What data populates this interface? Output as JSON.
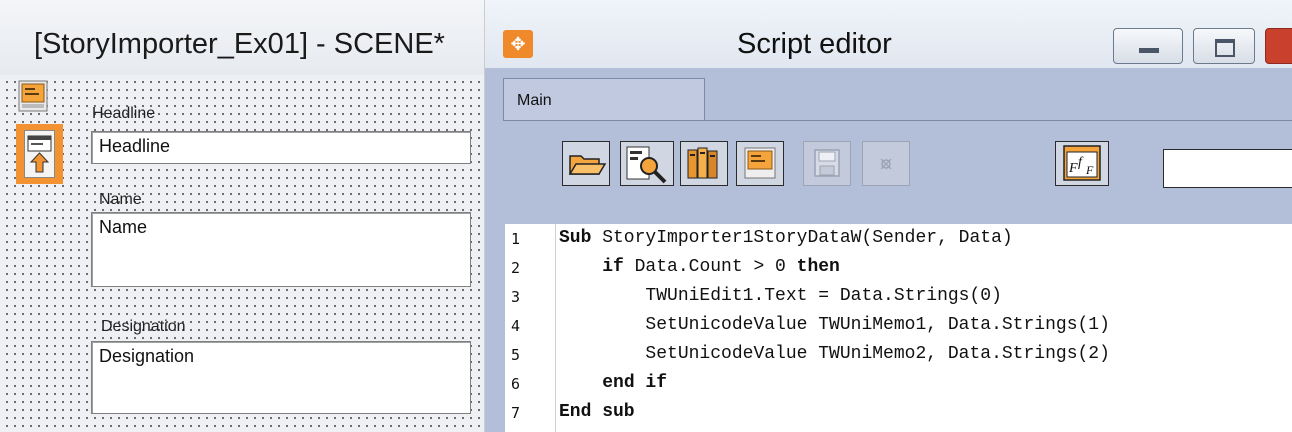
{
  "designer": {
    "title": "[StoryImporter_Ex01] - SCENE*",
    "fields": [
      {
        "label": "Headline",
        "value": "Headline"
      },
      {
        "label": "Name",
        "value": "Name"
      },
      {
        "label": "Designation",
        "value": "Designation"
      }
    ]
  },
  "editor": {
    "title": "Script editor",
    "tab": "Main",
    "toolbar": [
      "open-icon",
      "object-inspector-icon",
      "library-icon",
      "form-icon",
      "save-icon",
      "disabled-icon",
      "function-icon"
    ],
    "field_value": "",
    "lines": [
      {
        "num": "1",
        "kw1": "Sub",
        "text": " StoryImporter1StoryDataW(Sender, Data)",
        "kw2": "",
        "indent": ""
      },
      {
        "num": "2",
        "kw1": "if",
        "text": " Data.Count > 0 ",
        "kw2": "then",
        "indent": "    "
      },
      {
        "num": "3",
        "kw1": "",
        "text": "TWUniEdit1.Text = Data.Strings(0)",
        "kw2": "",
        "indent": "        "
      },
      {
        "num": "4",
        "kw1": "",
        "text": "SetUnicodeValue TWUniMemo1, Data.Strings(1)",
        "kw2": "",
        "indent": "        "
      },
      {
        "num": "5",
        "kw1": "",
        "text": "SetUnicodeValue TWUniMemo2, Data.Strings(2)",
        "kw2": "",
        "indent": "        "
      },
      {
        "num": "6",
        "kw1": "end if",
        "text": "",
        "kw2": "",
        "indent": "    "
      },
      {
        "num": "7",
        "kw1": "End sub",
        "text": "",
        "kw2": "",
        "indent": ""
      }
    ]
  }
}
